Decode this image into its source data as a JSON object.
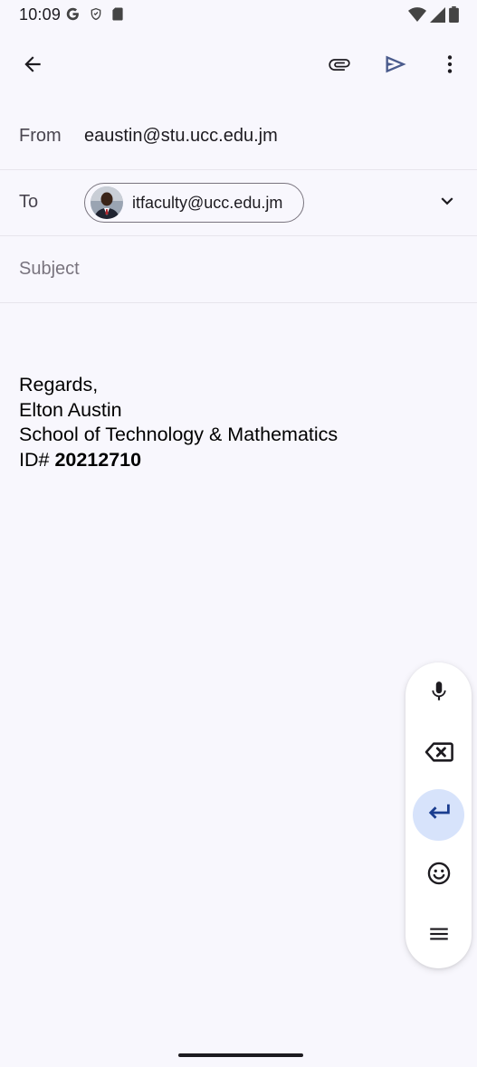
{
  "status_bar": {
    "time": "10:09",
    "left_icons": [
      "google-g-icon",
      "shield-icon",
      "sd-card-icon"
    ],
    "right_icons": [
      "wifi-icon",
      "signal-icon",
      "battery-icon"
    ]
  },
  "app_bar": {
    "back_icon": "arrow-back-icon",
    "attach_icon": "paperclip-icon",
    "send_icon": "send-icon",
    "more_icon": "more-vert-icon"
  },
  "compose": {
    "from_label": "From",
    "from_value": "eaustin@stu.ucc.edu.jm",
    "to_label": "To",
    "to_chip": "itfaculty@ucc.edu.jm",
    "subject_placeholder": "Subject",
    "body": {
      "line1": "Regards,",
      "line2": "Elton Austin",
      "line3": "School of Technology & Mathematics",
      "line4_prefix": "ID# ",
      "line4_bold": "20212710"
    }
  },
  "keyboard_toolbar": {
    "items": [
      "mic-icon",
      "backspace-icon",
      "enter-icon",
      "emoji-icon",
      "menu-icon"
    ],
    "accent": "#d7e3fb"
  },
  "colors": {
    "background": "#f8f7fd",
    "send_icon": "#4a5b8c"
  }
}
